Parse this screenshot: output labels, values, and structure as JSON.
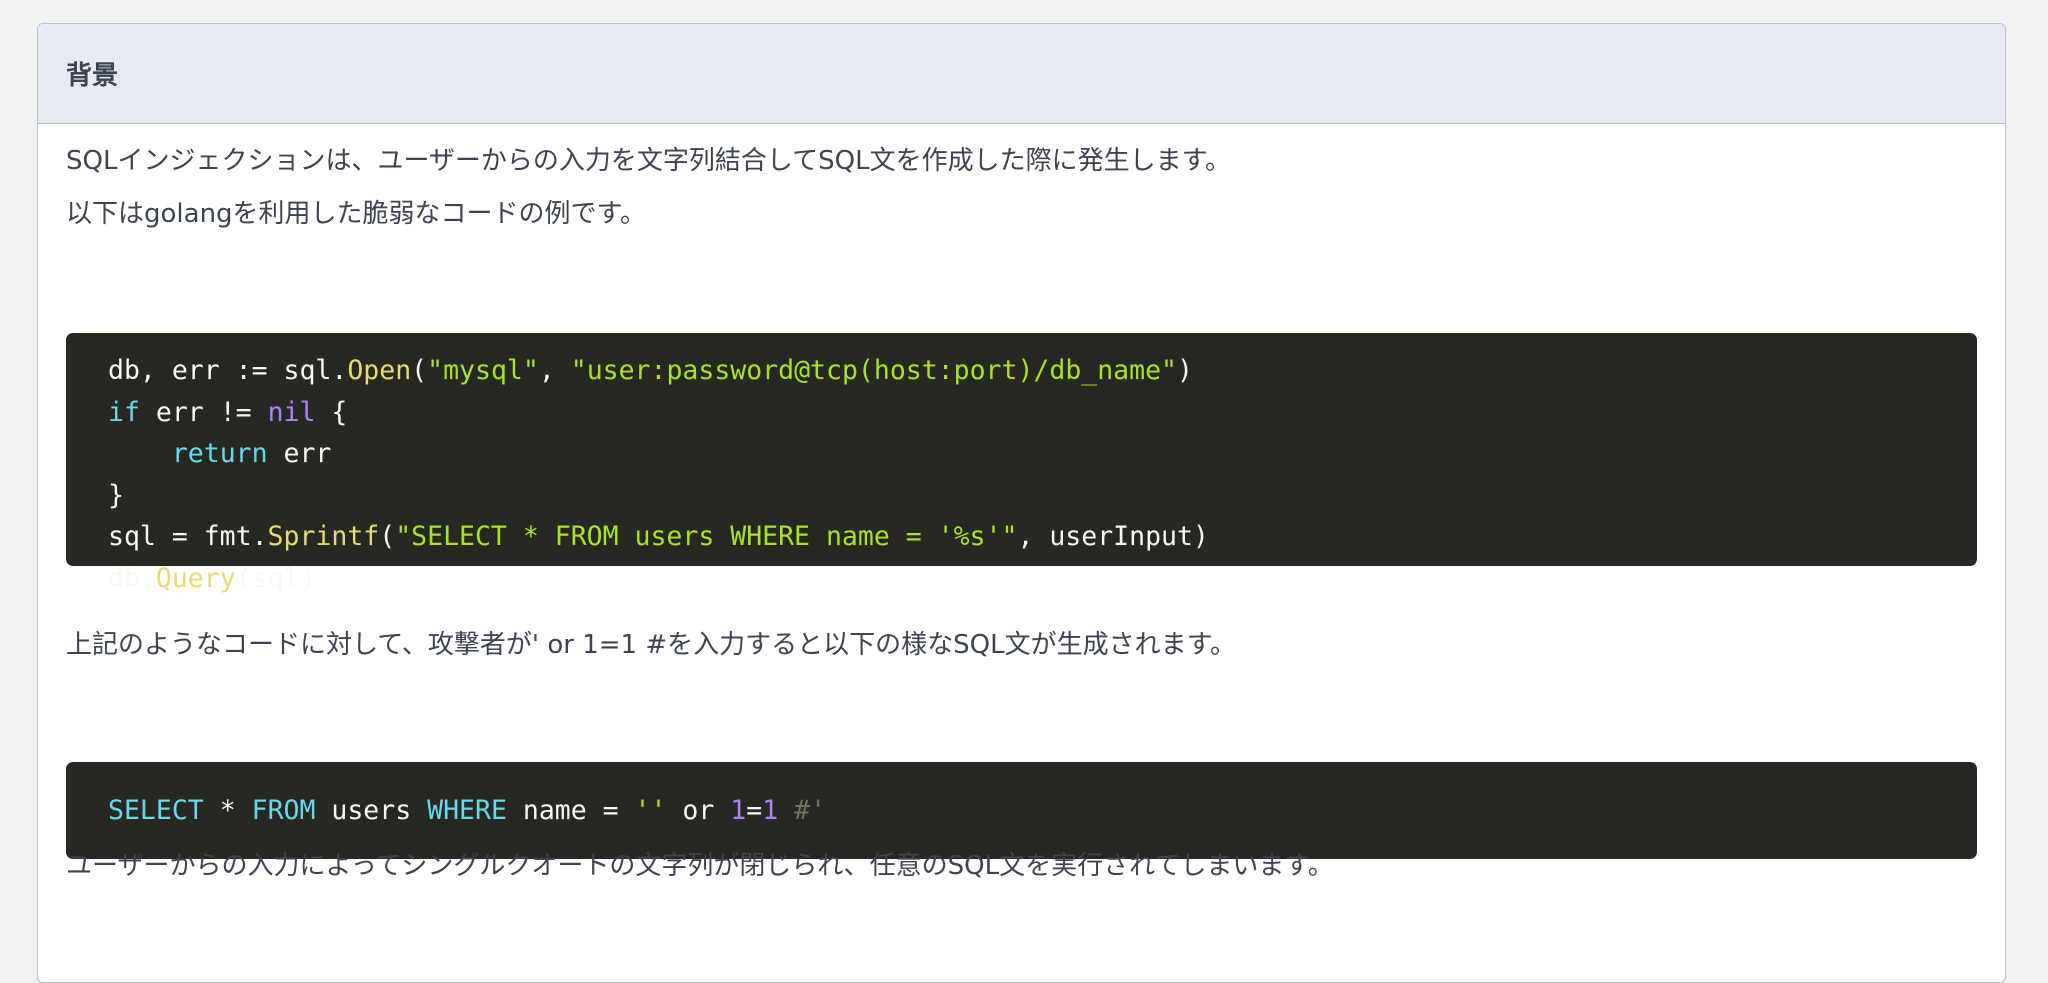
{
  "section": {
    "title": "背景"
  },
  "paragraphs": {
    "intro": "SQLインジェクションは、ユーザーからの入力を文字列結合してSQL文を作成した際に発生します。",
    "example_intro": "以下はgolangを利用した脆弱なコードの例です。",
    "attack_intro": "上記のようなコードに対して、攻撃者が' or 1=1 #を入力すると以下の様なSQL文が生成されます。",
    "conclusion": "ユーザーからの入力によってシングルクオートの文字列が閉じられ、任意のSQL文を実行されてしまいます。"
  },
  "code_go": {
    "line1": [
      "db, err := sql.",
      "Open",
      "(",
      "\"mysql\"",
      ", ",
      "\"user:password@tcp(host:port)/db_name\"",
      ")"
    ],
    "line2": [
      "if",
      " err != ",
      "nil",
      " {"
    ],
    "line3": [
      "    ",
      "return",
      " err"
    ],
    "line4": [
      "}"
    ],
    "line5": [
      "sql = fmt.",
      "Sprintf",
      "(",
      "\"SELECT * FROM users WHERE name = '%s'\"",
      ", userInput)"
    ],
    "line6": [
      "db.",
      "Query",
      "(sql)"
    ]
  },
  "code_sql": {
    "line1": [
      "SELECT",
      " * ",
      "FROM",
      " users ",
      "WHERE",
      " name = ",
      "''",
      " or ",
      "1",
      "=",
      "1",
      " #'"
    ]
  },
  "colors": {
    "code_background": "#272822",
    "string": "#a6e22e",
    "function": "#e6db74",
    "keyword": "#66d9ef",
    "constant": "#ae81ff",
    "comment": "#75715e"
  }
}
